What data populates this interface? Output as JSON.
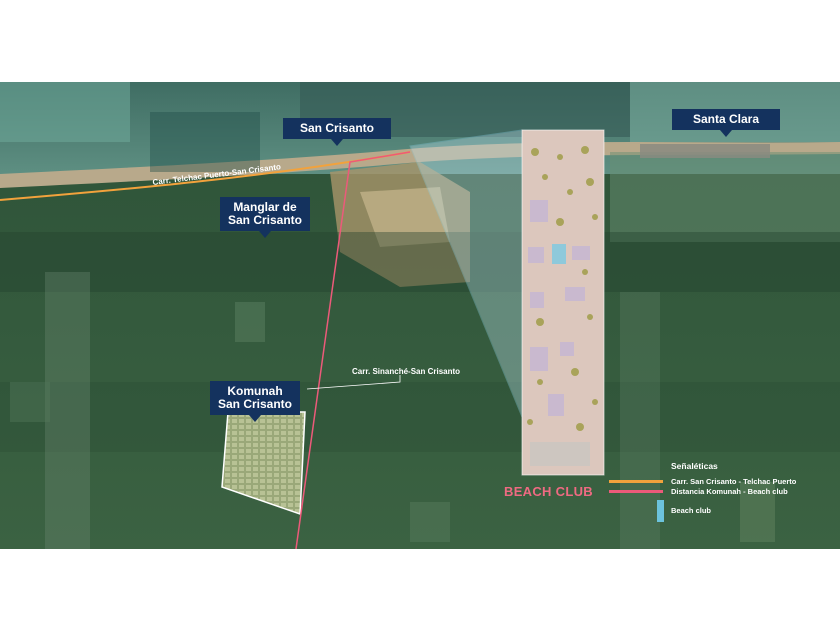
{
  "map": {
    "labels": {
      "san_crisanto": "San Crisanto",
      "santa_clara": "Santa Clara",
      "manglar": "Manglar de San Crisanto",
      "komunah": "Komunah San Crisanto"
    },
    "roads": {
      "telchac": "Carr. Telchac Puerto-San Crisanto",
      "sinanche": "Carr. Sinanché-San Crisanto"
    },
    "beach_club_title": "BEACH CLUB"
  },
  "legend": {
    "title": "Señaléticas",
    "items": [
      {
        "label": "Carr. San Crisanto - Telchac Puerto",
        "color": "#f2a23c"
      },
      {
        "label": "Distancia Komunah - Beach club",
        "color": "#ec5a7a"
      },
      {
        "label": "Beach club",
        "color": "#6cc3dd"
      }
    ]
  },
  "colors": {
    "callout_bg": "#14325e",
    "road_orange": "#f2a23c",
    "road_pink": "#ec5a7a",
    "beach_blue": "#6cc3dd"
  }
}
